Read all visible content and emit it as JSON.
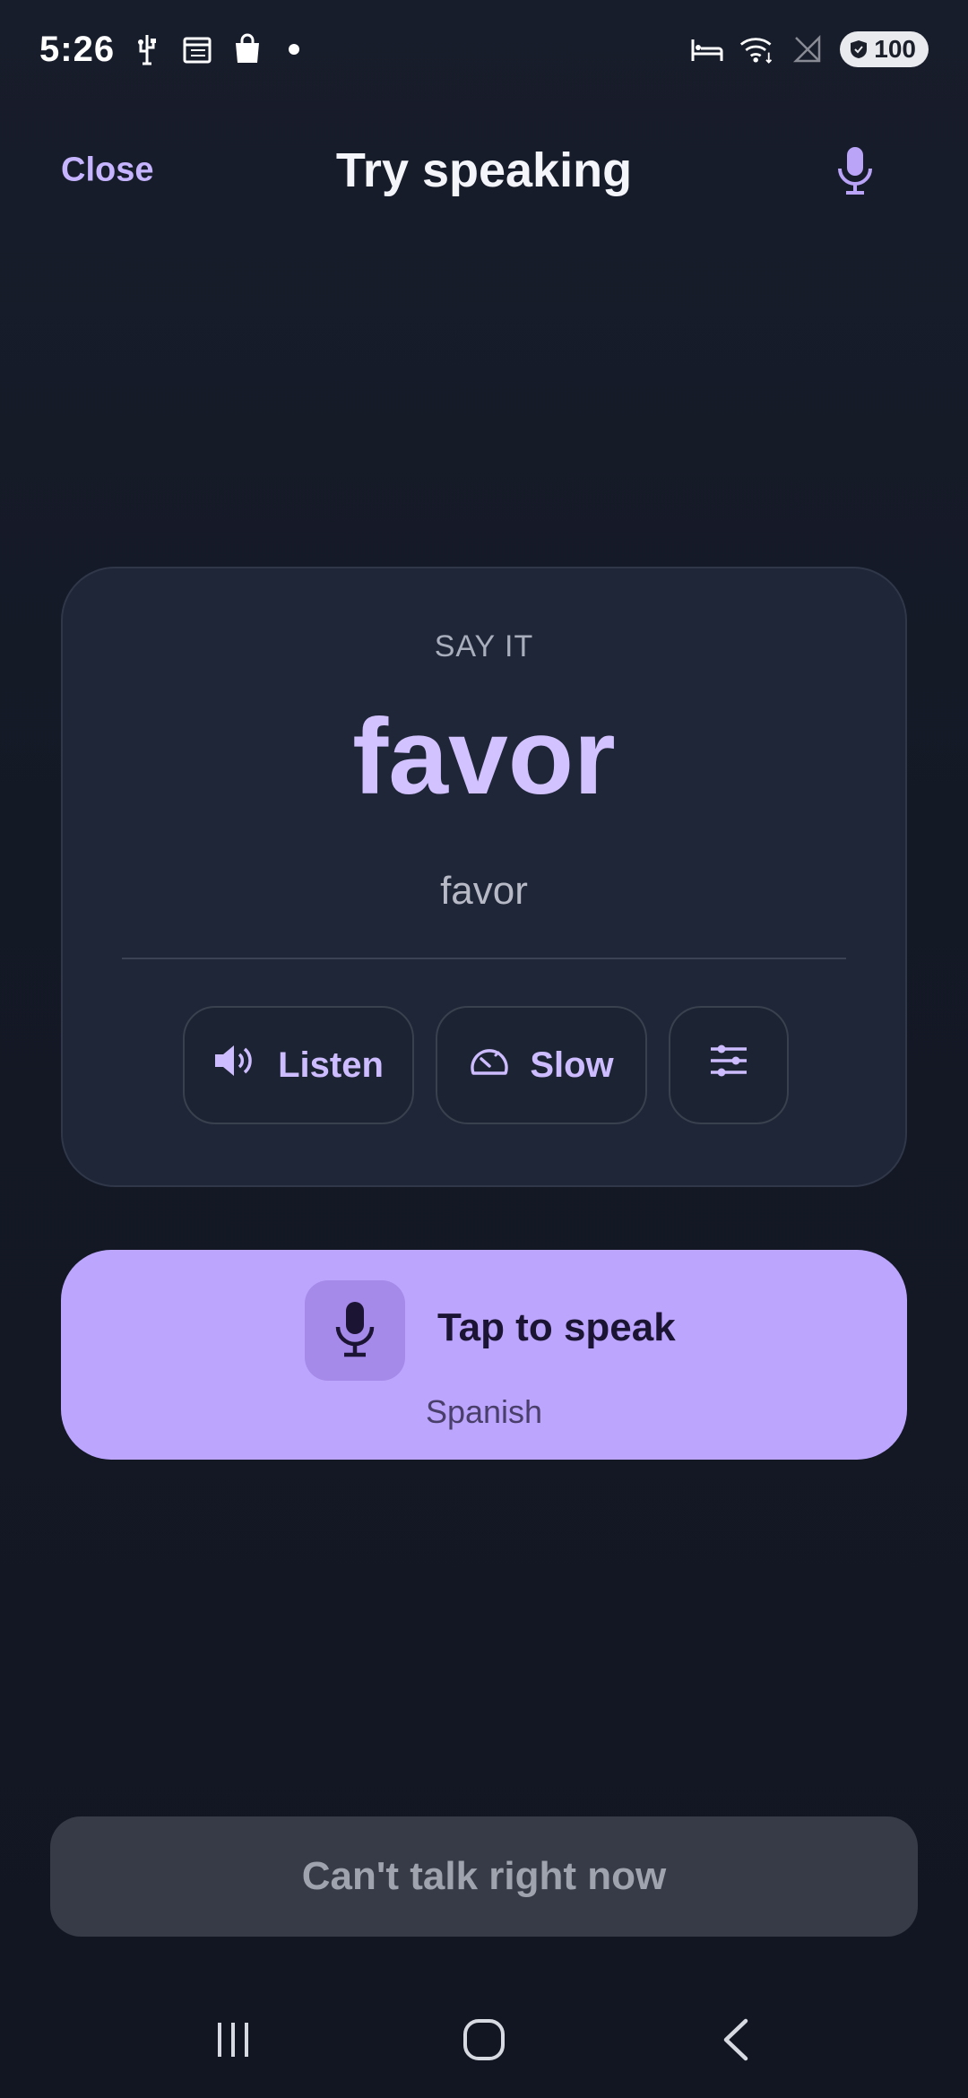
{
  "status_bar": {
    "time": "5:26",
    "battery": "100"
  },
  "header": {
    "close_label": "Close",
    "title": "Try speaking"
  },
  "card": {
    "prompt_label": "SAY IT",
    "word": "favor",
    "translation": "favor",
    "listen_label": "Listen",
    "slow_label": "Slow"
  },
  "speak": {
    "label": "Tap to speak",
    "language": "Spanish"
  },
  "footer": {
    "cant_talk_label": "Can't talk right now"
  },
  "colors": {
    "accent": "#c6b4ff",
    "speak_button": "#bca6fd",
    "background": "#121622",
    "card": "#1f2637"
  }
}
